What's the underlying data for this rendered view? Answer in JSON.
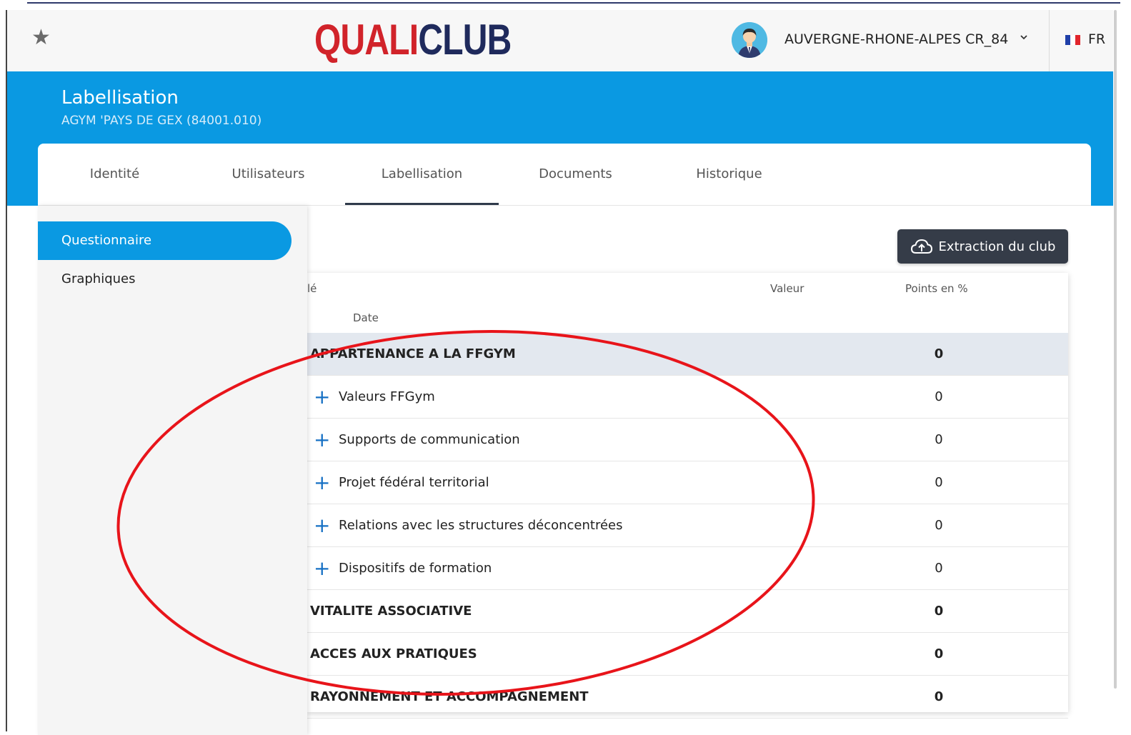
{
  "header": {
    "logo_part1": "QUALI",
    "logo_part2": "CLUB",
    "user_name": "AUVERGNE-RHONE-ALPES CR_84",
    "language": "FR"
  },
  "banner": {
    "title": "Labellisation",
    "subtitle": "AGYM 'PAYS DE GEX (84001.010)"
  },
  "tabs": [
    {
      "label": "Identité"
    },
    {
      "label": "Utilisateurs"
    },
    {
      "label": "Labellisation",
      "active": true
    },
    {
      "label": "Documents"
    },
    {
      "label": "Historique"
    }
  ],
  "sidebar": {
    "items": [
      {
        "label": "Questionnaire",
        "active": true
      },
      {
        "label": "Graphiques"
      }
    ]
  },
  "toolbar": {
    "extract_label": "Extraction du club"
  },
  "table": {
    "headers": {
      "col_partial": "lé",
      "date": "Date",
      "valeur": "Valeur",
      "points": "Points en %"
    },
    "rows": [
      {
        "label": "APPARTENANCE A LA FFGYM",
        "points": "0",
        "type": "section"
      },
      {
        "label": "Valeurs FFGym",
        "points": "0",
        "type": "sub"
      },
      {
        "label": "Supports de communication",
        "points": "0",
        "type": "sub"
      },
      {
        "label": "Projet fédéral territorial",
        "points": "0",
        "type": "sub"
      },
      {
        "label": "Relations avec les structures déconcentrées",
        "points": "0",
        "type": "sub"
      },
      {
        "label": "Dispositifs de formation",
        "points": "0",
        "type": "sub"
      },
      {
        "label": "VITALITE ASSOCIATIVE",
        "points": "0",
        "type": "section"
      },
      {
        "label": "ACCES AUX PRATIQUES",
        "points": "0",
        "type": "section"
      },
      {
        "label": "RAYONNEMENT ET ACCOMPAGNEMENT",
        "points": "0",
        "type": "section"
      }
    ]
  },
  "colors": {
    "brand_blue": "#0a99e2",
    "logo_red": "#d1232a",
    "logo_navy": "#1f2a5c",
    "button_dark": "#353c48",
    "annotation_red": "#e8141a"
  },
  "icons": [
    "star-icon",
    "avatar-icon",
    "chevron-down-icon",
    "france-flag-icon",
    "cloud-upload-icon",
    "plus-icon"
  ]
}
